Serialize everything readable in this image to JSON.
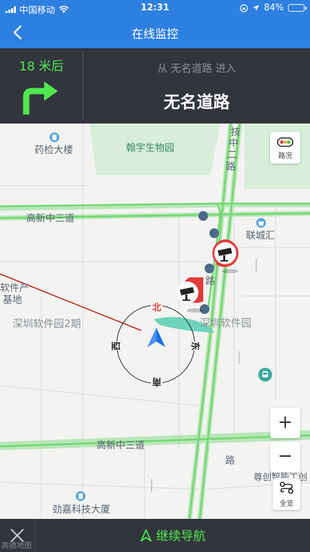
{
  "status_bar": {
    "carrier": "中国移动",
    "time": "12:31",
    "battery": "84%",
    "battery_level": 0.84
  },
  "nav_bar": {
    "title": "在线监控",
    "back_icon": "chevron-left-icon"
  },
  "guidance": {
    "distance": "18 米后",
    "turn_icon": "turn-right-arrow-icon",
    "from_text": "从 无名道路 进入",
    "road_name": "无名道路"
  },
  "map": {
    "labels": {
      "yaojian": "药检大楼",
      "hanyu": "翰宇生物园",
      "gaoxin_top": "高新中三道",
      "liancheng": "联城汇",
      "ruanjian_left": "软件产",
      "jidi": "基地",
      "shenzhen_2": "深圳软件园2期",
      "shenzhen": "深圳软件园",
      "gaoxin_bottom": "高新中三道",
      "zunchuang": "尊创智能工创",
      "jinjia": "劲嘉科技大厦",
      "keji_road_1": "技",
      "keji_road_2": "中",
      "keji_road_3": "二",
      "keji_road_4": "路",
      "road_mid": "路",
      "road_bottom": "路"
    },
    "compass": {
      "north": "北",
      "south": "南",
      "east": "东",
      "west": "西"
    },
    "traffic_label": "路况",
    "zoom_in": "+",
    "zoom_out": "−",
    "overview_label": "全览",
    "colors": {
      "road_green": "#6fd86f",
      "green_area": "#d8edda",
      "route_red": "#b8261f",
      "camera_red": "#e23b3b"
    }
  },
  "bottom_bar": {
    "continue_label": "继续导航",
    "watermark": "高德地图"
  }
}
